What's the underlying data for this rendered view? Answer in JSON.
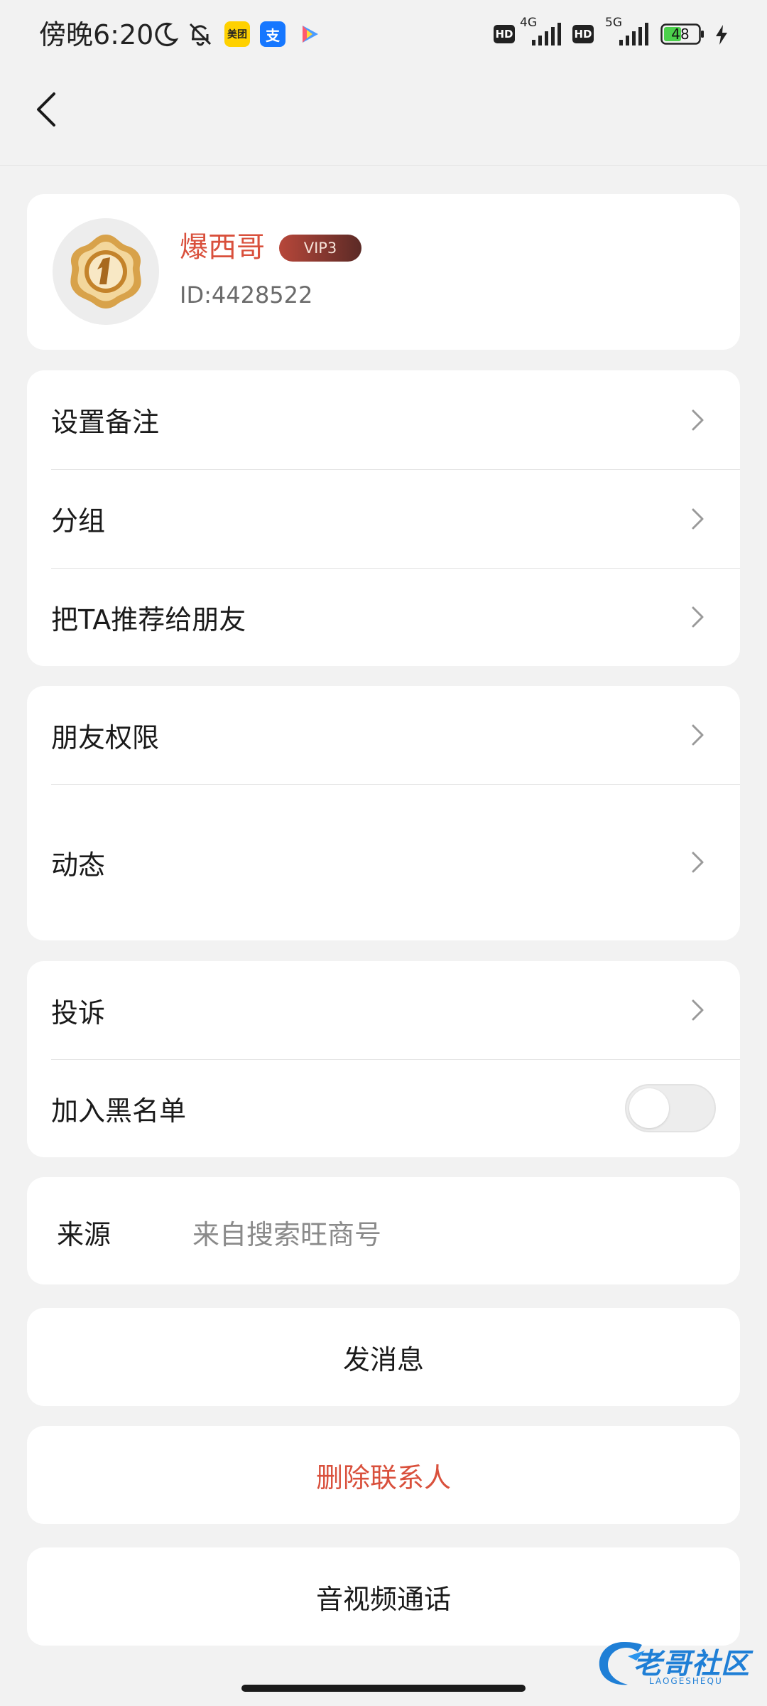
{
  "status_bar": {
    "time": "傍晚6:20",
    "app_badges": [
      "美团",
      "支"
    ],
    "network": [
      "4G",
      "5G"
    ],
    "hd_label": "HD",
    "battery": "48",
    "icons": [
      "moon-icon",
      "bell-off-icon",
      "meituan-icon",
      "alipay-icon",
      "play-icon",
      "signal-icon",
      "battery-icon",
      "charging-icon"
    ]
  },
  "header": {
    "back_icon": "chevron-left-icon"
  },
  "profile": {
    "name": "爆西哥",
    "vip": "VIP3",
    "id": "ID:4428522"
  },
  "group1": [
    {
      "label": "设置备注"
    },
    {
      "label": "分组"
    },
    {
      "label": "把TA推荐给朋友"
    }
  ],
  "group2": [
    {
      "label": "朋友权限"
    },
    {
      "label": "动态"
    }
  ],
  "group3": {
    "complaint": "投诉",
    "blacklist": "加入黑名单",
    "blacklist_on": false
  },
  "source": {
    "label": "来源",
    "value": "来自搜索旺商号"
  },
  "actions": {
    "send_message": "发消息",
    "delete_contact": "删除联系人",
    "av_call": "音视频通话"
  },
  "watermark": {
    "text": "老哥社区",
    "sub": "LAOGESHEQU"
  },
  "colors": {
    "accent_red": "#d9503c",
    "background": "#f2f2f2",
    "card": "#ffffff"
  }
}
